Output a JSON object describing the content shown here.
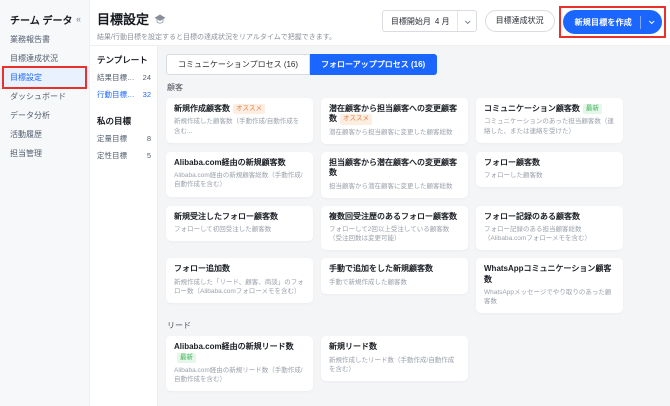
{
  "colors": {
    "accent": "#1b66ff",
    "annotation": "#e8312a"
  },
  "sidebar": {
    "title": "チーム データ",
    "items": [
      {
        "label": "業務報告書",
        "active": false
      },
      {
        "label": "目標達成状況",
        "active": false
      },
      {
        "label": "目標設定",
        "active": true,
        "name": "sidebar-item-goal-setting"
      },
      {
        "label": "ダッシュボード",
        "active": false
      },
      {
        "label": "データ分析",
        "active": false
      },
      {
        "label": "活動履歴",
        "active": false
      },
      {
        "label": "担当管理",
        "active": false
      }
    ]
  },
  "header": {
    "title": "目標設定",
    "subtitle": "結果/行動目標を設定すると目標の達成状況をリアルタイムで把握できます。",
    "month_filter": {
      "label": "目標開始月",
      "value": "4 月"
    },
    "status_button": "目標達成状況",
    "create_button": "新規目標を作成"
  },
  "template_panel": {
    "sections": [
      {
        "title": "テンプレート",
        "items": [
          {
            "label": "結果目標テンプ...",
            "count": "24",
            "active": false
          },
          {
            "label": "行動目標テンプ...",
            "count": "32",
            "active": true
          }
        ]
      },
      {
        "title": "私の目標",
        "items": [
          {
            "label": "定量目標",
            "count": "8",
            "active": false
          },
          {
            "label": "定性目標",
            "count": "5",
            "active": false
          }
        ]
      }
    ]
  },
  "tabs": [
    {
      "label": "コミュニケーションプロセス (16)",
      "active": false
    },
    {
      "label": "フォローアッププロセス (16)",
      "active": true
    }
  ],
  "sections": [
    {
      "title": "顧客",
      "cards": [
        {
          "title": "新規作成顧客数",
          "badge": {
            "text": "オススメ",
            "type": "recommend"
          },
          "desc": "新規作成した顧客数（手動作成/自動作成を含む..."
        },
        {
          "title": "潜在顧客から担当顧客への変更顧客数",
          "badge": {
            "text": "オススメ",
            "type": "recommend"
          },
          "desc": "潜在顧客から担当顧客に変更した顧客総数"
        },
        {
          "title": "コミュニケーション顧客数",
          "badge": {
            "text": "最新",
            "type": "new"
          },
          "desc": "コミュニケーションのあった担当顧客数（連絡した、または連絡を受けた）"
        },
        {
          "title": "Alibaba.com経由の新規顧客数",
          "badge": null,
          "desc": "Alibaba.com経由の新規顧客総数（手動作成/自動作成を含む）"
        },
        {
          "title": "担当顧客から潜在顧客への変更顧客数",
          "badge": null,
          "desc": "担当顧客から潜在顧客に変更した顧客総数"
        },
        {
          "title": "フォロー顧客数",
          "badge": null,
          "desc": "フォローした顧客数"
        },
        {
          "title": "新規受注したフォロー顧客数",
          "badge": null,
          "desc": "フォローして初回受注した顧客数"
        },
        {
          "title": "複数回受注歴のあるフォロー顧客数",
          "badge": null,
          "desc": "フォローして2回以上受注している顧客数（受注回数は変更可能）"
        },
        {
          "title": "フォロー記録のある顧客数",
          "badge": null,
          "desc": "フォロー記録のある担当顧客総数（Alibaba.comフォローメモを含む）"
        },
        {
          "title": "フォロー追加数",
          "badge": null,
          "desc": "新規作成した「リード、顧客、商談」のフォロー数（Alibaba.comフォローメモを含む）"
        },
        {
          "title": "手動で追加をした新規顧客数",
          "badge": null,
          "desc": "手動で新規作成した顧客数"
        },
        {
          "title": "WhatsAppコミュニケーション顧客数",
          "badge": null,
          "desc": "WhatsAppメッセージでやり取りのあった顧客数"
        }
      ]
    },
    {
      "title": "リード",
      "cards": [
        {
          "title": "Alibaba.com経由の新規リード数",
          "badge": {
            "text": "最新",
            "type": "new"
          },
          "desc": "Alibaba.com経由の新規リード数（手動作成/自動作成を含む）"
        },
        {
          "title": "新規リード数",
          "badge": null,
          "desc": "新規作成したリード数（手動作成/自動作成を含む）"
        }
      ]
    }
  ],
  "annotations": [
    {
      "target_name": "sidebar-item-goal-setting",
      "pad_x": -2,
      "pad_y": 2
    },
    {
      "target_name": "create-goal-button",
      "pad_x": 4,
      "pad_y": 4
    }
  ]
}
